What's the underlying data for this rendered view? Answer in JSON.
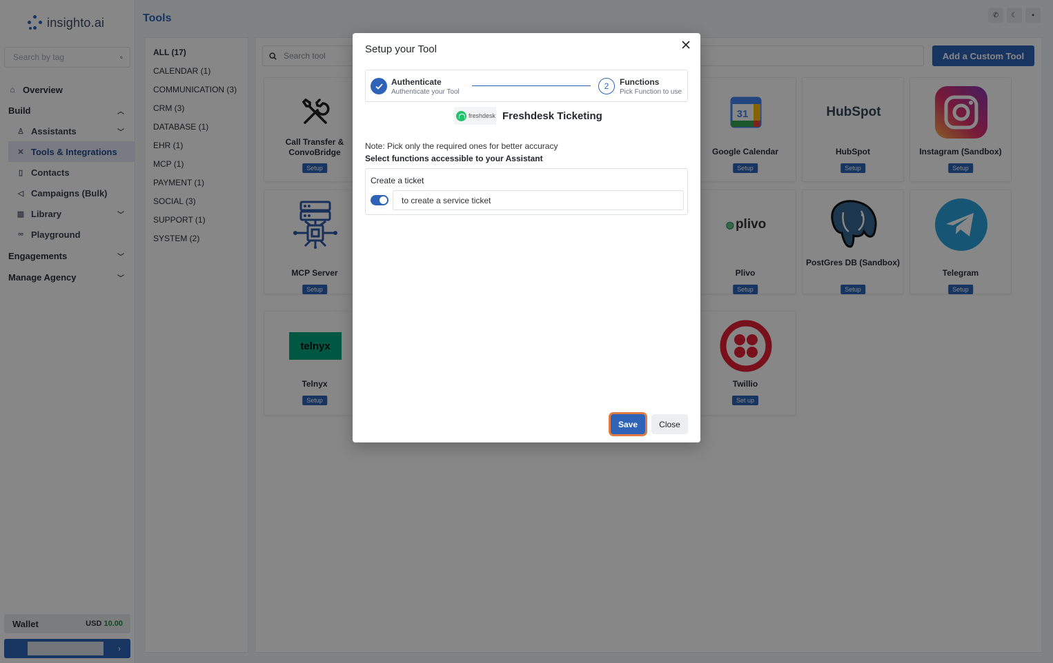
{
  "app": {
    "brand": "insighto.ai",
    "page_title": "Tools"
  },
  "sidebar": {
    "search_placeholder": "Search by tag",
    "items": [
      {
        "label": "Overview"
      },
      {
        "label": "Build"
      },
      {
        "label": "Assistants"
      },
      {
        "label": "Tools & Integrations"
      },
      {
        "label": "Contacts"
      },
      {
        "label": "Campaigns (Bulk)"
      },
      {
        "label": "Library"
      },
      {
        "label": "Playground"
      },
      {
        "label": "Engagements"
      },
      {
        "label": "Manage Agency"
      }
    ],
    "wallet": {
      "label": "Wallet",
      "currency": "USD",
      "amount": "10.00"
    }
  },
  "categories": [
    "ALL (17)",
    "CALENDAR (1)",
    "COMMUNICATION (3)",
    "CRM (3)",
    "DATABASE (1)",
    "EHR (1)",
    "MCP (1)",
    "PAYMENT (1)",
    "SOCIAL (3)",
    "SUPPORT (1)",
    "SYSTEM (2)"
  ],
  "tools": {
    "search_placeholder": "Search tool",
    "add_button": "Add a Custom Tool",
    "cards": [
      {
        "name": "Call Transfer & ConvoBridge",
        "action": "Setup"
      },
      {
        "name": "Google Calendar",
        "action": "Setup"
      },
      {
        "name": "HubSpot",
        "action": "Setup"
      },
      {
        "name": "Instagram (Sandbox)",
        "action": "Setup"
      },
      {
        "name": "MCP Server",
        "action": "Setup"
      },
      {
        "name": "Plivo",
        "action": "Setup"
      },
      {
        "name": "PostGres DB (Sandbox)",
        "action": "Setup"
      },
      {
        "name": "Telegram",
        "action": "Setup"
      },
      {
        "name": "Telnyx",
        "action": "Setup"
      },
      {
        "name": "Twillio",
        "action": "Set up"
      }
    ],
    "logo_text": {
      "hubspot": "HubSpot",
      "plivo": "plivo",
      "telnyx": "telnyx",
      "gcal_day": "31"
    }
  },
  "modal": {
    "title": "Setup your Tool",
    "steps": [
      {
        "title": "Authenticate",
        "subtitle": "Authenticate your Tool"
      },
      {
        "number": "2",
        "title": "Functions",
        "subtitle": "Pick Function to use"
      }
    ],
    "brand_logo_text": "freshdesk",
    "tool_name": "Freshdesk Ticketing",
    "note": "Note: Pick only the required ones for better accuracy",
    "select_label": "Select functions accessible to your Assistant",
    "functions": [
      {
        "name": "Create a ticket",
        "enabled": true,
        "description": "to create a service ticket"
      }
    ],
    "save_label": "Save",
    "close_label": "Close"
  },
  "colors": {
    "primary": "#2e63b8",
    "focus_ring": "#e07a45",
    "wallet_amount": "#1e8a3c"
  }
}
